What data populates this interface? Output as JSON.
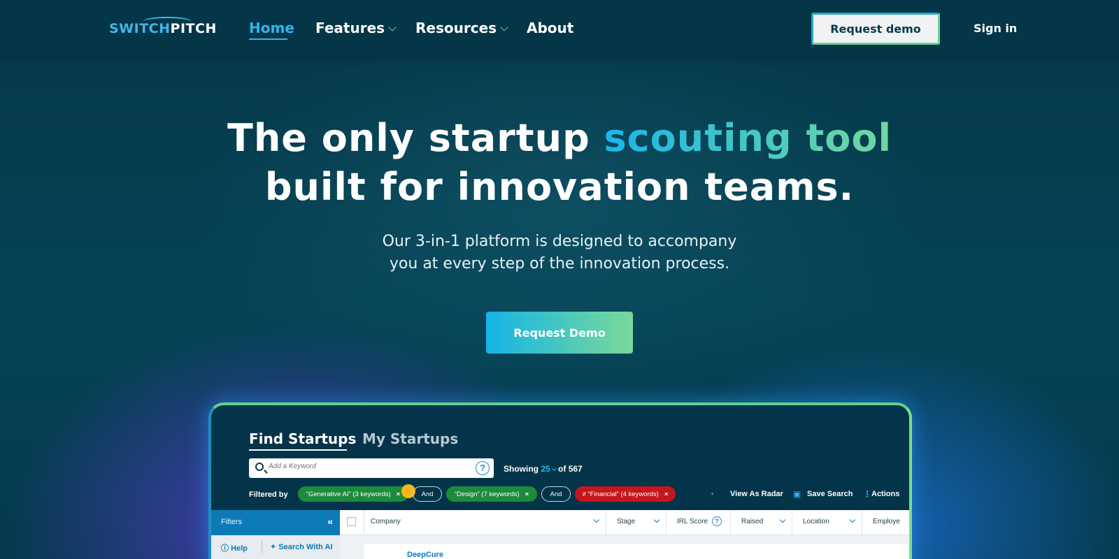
{
  "nav": {
    "logo_part1": "SWITCH",
    "logo_part2": "PITCH",
    "links": [
      {
        "label": "Home",
        "active": true
      },
      {
        "label": "Features",
        "dropdown": true
      },
      {
        "label": "Resources",
        "dropdown": true
      },
      {
        "label": "About"
      }
    ],
    "request_demo": "Request demo",
    "sign_in": "Sign in"
  },
  "hero": {
    "title_line1_a": "The only startup ",
    "title_line1_b": "scouting tool",
    "title_line2": "built for innovation teams.",
    "subtitle_line1": "Our 3-in-1 platform is designed to accompany",
    "subtitle_line2": "you at every step of the innovation process.",
    "cta": "Request Demo"
  },
  "app": {
    "tabs": [
      "Find Startups",
      "My Startups"
    ],
    "search_placeholder": "Add a Keyword",
    "help_glyph": "?",
    "showing_label": "Showing",
    "showing_count": "25",
    "showing_total": "of 567",
    "filtered_by": "Filtered by",
    "chips": [
      {
        "label": "“Generative AI” (3 keywords)",
        "x": "×"
      },
      {
        "label": "And"
      },
      {
        "label": "“Design” (7 keywords)",
        "x": "×"
      },
      {
        "label": "And"
      },
      {
        "label": "≠ “Financial” (4 keywords)",
        "x": "×"
      }
    ],
    "actions": [
      "View As Radar",
      "Save Search",
      "Actions"
    ],
    "filters_label": "Filters",
    "filters_collapse": "«",
    "help_link": "Help",
    "ai_link": "Search With AI",
    "columns": [
      "Company",
      "Stage",
      "IRL Score",
      "Raised",
      "Location",
      "Employe"
    ],
    "rows": [
      {
        "company": "DeepCure"
      }
    ],
    "colors": {
      "accent_blue": "#2fb5ea",
      "accent_green": "#72d8a0",
      "chip_green": "#1e8a3c",
      "chip_red": "#c4161c"
    }
  }
}
